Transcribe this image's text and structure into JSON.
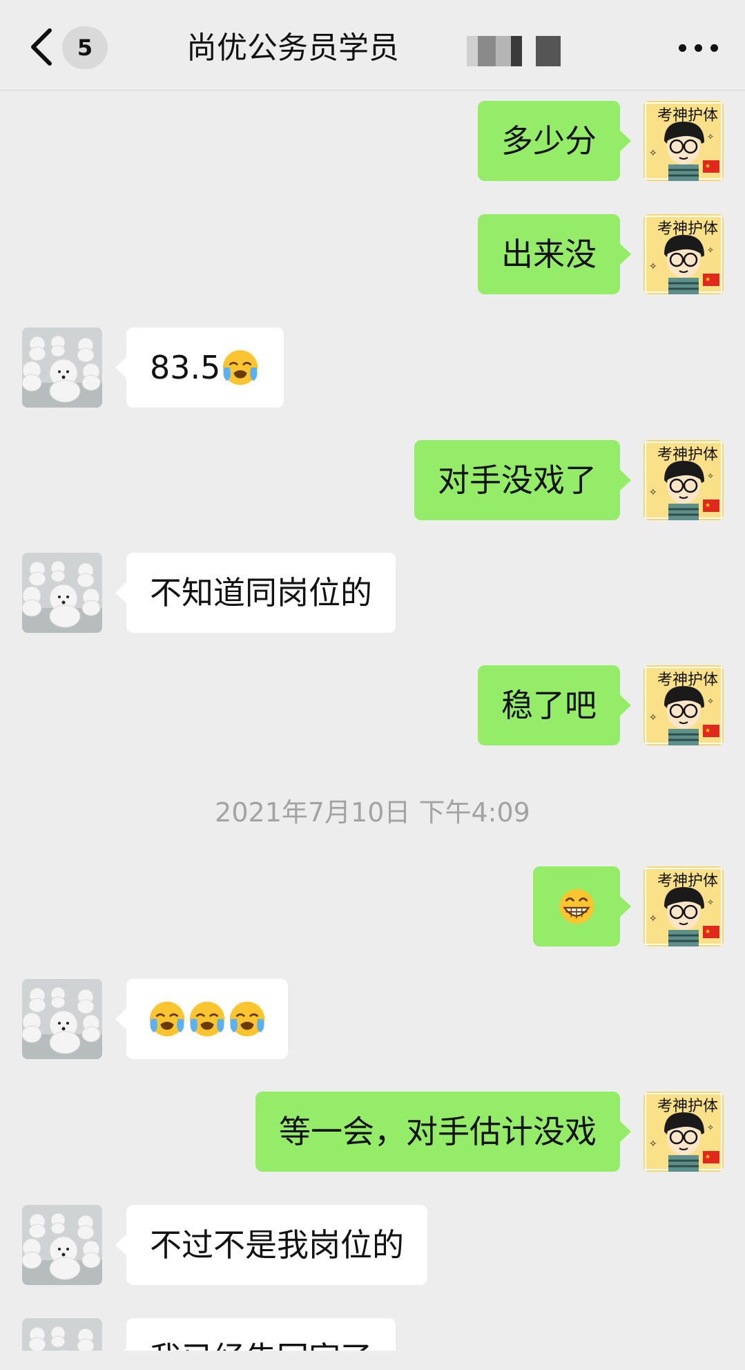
{
  "header": {
    "back_icon": "chevron-left-icon",
    "unread_count": "5",
    "title": "尚优公务员学员",
    "more_icon": "more-dots-icon"
  },
  "messages": [
    {
      "side": "self",
      "text": "多少分"
    },
    {
      "side": "self",
      "text": "出来没"
    },
    {
      "side": "other",
      "text": "83.5",
      "emoji": "loudly-crying-face-icon"
    },
    {
      "side": "self",
      "text": "对手没戏了"
    },
    {
      "side": "other",
      "text": "不知道同岗位的"
    },
    {
      "side": "self",
      "text": "稳了吧"
    },
    {
      "side": "self",
      "emoji": "grinning-face-icon"
    },
    {
      "side": "other",
      "emoji": "loudly-crying-face-icon x3"
    },
    {
      "side": "self",
      "text": "等一会，对手估计没戏"
    },
    {
      "side": "other",
      "text": "不过不是我岗位的"
    },
    {
      "side": "other",
      "text": "我已经告回家了"
    }
  ],
  "timestamp": "2021年7月10日 下午4:09",
  "colors": {
    "background": "#ededed",
    "self_bubble": "#95ec69",
    "other_bubble": "#ffffff",
    "timestamp_text": "#a3a3a3"
  }
}
